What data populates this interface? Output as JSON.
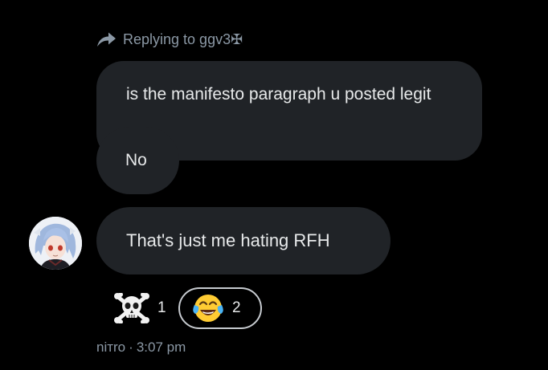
{
  "reply_context": {
    "text": "Replying to ggv3✠"
  },
  "messages": [
    {
      "text": "is the manifesto paragraph u posted legit"
    },
    {
      "text": "No"
    },
    {
      "text": "That's just me hating RFH"
    }
  ],
  "reactions": [
    {
      "icon": "skull-and-crossbones-icon",
      "count": "1"
    },
    {
      "icon": "face-with-tears-of-joy-icon",
      "count": "2"
    }
  ],
  "meta": {
    "sender": "nітro",
    "separator": "·",
    "time": "3:07 pm"
  },
  "colors": {
    "background": "#000000",
    "bubble": "#202327",
    "text": "#e7e9ea",
    "muted": "#8b98a5"
  }
}
